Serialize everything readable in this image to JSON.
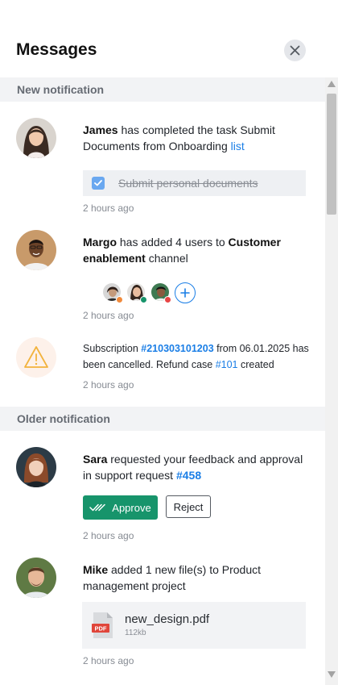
{
  "header": {
    "title": "Messages",
    "close_icon": "close-icon"
  },
  "sections": {
    "new": {
      "label": "New notification"
    },
    "older": {
      "label": "Older notification"
    }
  },
  "notifications": {
    "james": {
      "name": "James",
      "text": " has completed the task Submit Documents from Onboarding ",
      "link": "list",
      "task": {
        "label": "Submit personal documents",
        "checked": true
      },
      "time": "2 hours ago"
    },
    "margo": {
      "name": "Margo",
      "text1": " has added 4 users to ",
      "target": "Customer enablement",
      "text2": " channel",
      "users": [
        {
          "status_color": "#f08a3c"
        },
        {
          "status_color": "#17946b"
        },
        {
          "status_color": "#e84545"
        }
      ],
      "add_icon": "plus-icon",
      "time": "2 hours ago"
    },
    "subscription": {
      "icon": "warning-icon",
      "text1": "Subscription ",
      "subscription_id": "#210303101203",
      "text2": " from 06.01.2025 has been cancelled. Refund case ",
      "case_id": "#101",
      "text3": " created",
      "time": "2 hours ago"
    },
    "sara": {
      "name": "Sara",
      "text": " requested your feedback and approval in support request ",
      "request_id": "#458",
      "approve_label": "Approve",
      "reject_label": "Reject",
      "time": "2 hours ago"
    },
    "mike": {
      "name": "Mike",
      "text": " added 1 new file(s) to Product management project",
      "file": {
        "name": "new_design.pdf",
        "size": "112kb",
        "type_label": "PDF"
      },
      "time": "2 hours ago"
    }
  },
  "colors": {
    "accent": "#1a7ee6",
    "approve": "#17946b",
    "section_bg": "#f2f3f5"
  }
}
